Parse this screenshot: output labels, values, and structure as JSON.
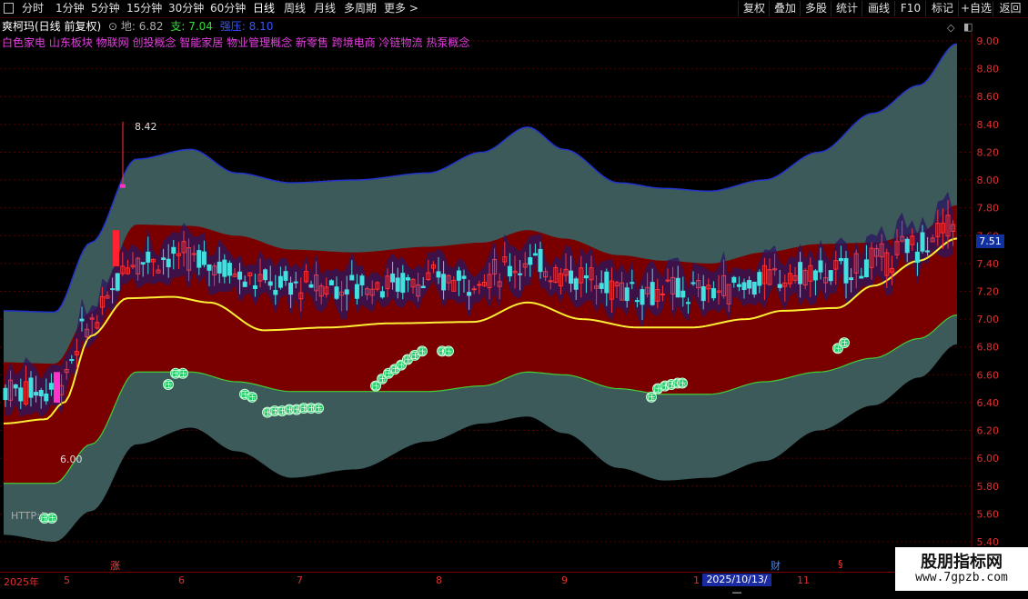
{
  "toolbar": {
    "periods": [
      "分时",
      "1分钟",
      "5分钟",
      "15分钟",
      "30分钟",
      "60分钟",
      "日线",
      "周线",
      "月线",
      "多周期",
      "更多 >"
    ],
    "active_period": "日线",
    "right_buttons": [
      "复权",
      "叠加",
      "多股",
      "统计",
      "画线",
      "F10",
      "标记",
      "+自选",
      "返回"
    ]
  },
  "info": {
    "stock": "爽柯玛(日线 前复权)",
    "support_label": "地:",
    "support_value": "6.82",
    "zhi_label": "支:",
    "zhi_value": "7.04",
    "pressure_label": "强压:",
    "pressure_value": "8.10"
  },
  "concepts": "白色家电 山东板块 物联网 创投概念 智能家居 物业管理概念 新零售 跨境电商 冷链物流 热泵概念",
  "price_axis": {
    "ticks": [
      "9.00",
      "8.80",
      "8.60",
      "8.40",
      "8.20",
      "8.00",
      "7.80",
      "7.60",
      "7.40",
      "7.20",
      "7.00",
      "6.80",
      "6.60",
      "6.40",
      "6.20",
      "6.00",
      "5.80",
      "5.60",
      "5.40"
    ],
    "current_price": "7.51"
  },
  "annotations": {
    "high_label": "8.42",
    "low_label": "6.00",
    "signal_char": "压",
    "http_text": "HTTP:/"
  },
  "time_axis": {
    "labels": [
      "2025年",
      "5",
      "6",
      "7",
      "8",
      "9",
      "1",
      "11"
    ],
    "cursor_date": "2025/10/13/—",
    "event_zhang": "涨",
    "event_cai": "财",
    "event_s": "§"
  },
  "watermark": {
    "line1": "股朋指标网",
    "line2": "www.7gpzb.com"
  },
  "colors": {
    "outer_band": "#3d5a5a",
    "inner_band": "#7a0000",
    "core_band": "#2a1560",
    "midline": "#ffee33",
    "lower_line": "#44cc33",
    "upper_line": "#2233cc",
    "up_candle": "#ff3333",
    "down_candle": "#44e0e0"
  }
}
